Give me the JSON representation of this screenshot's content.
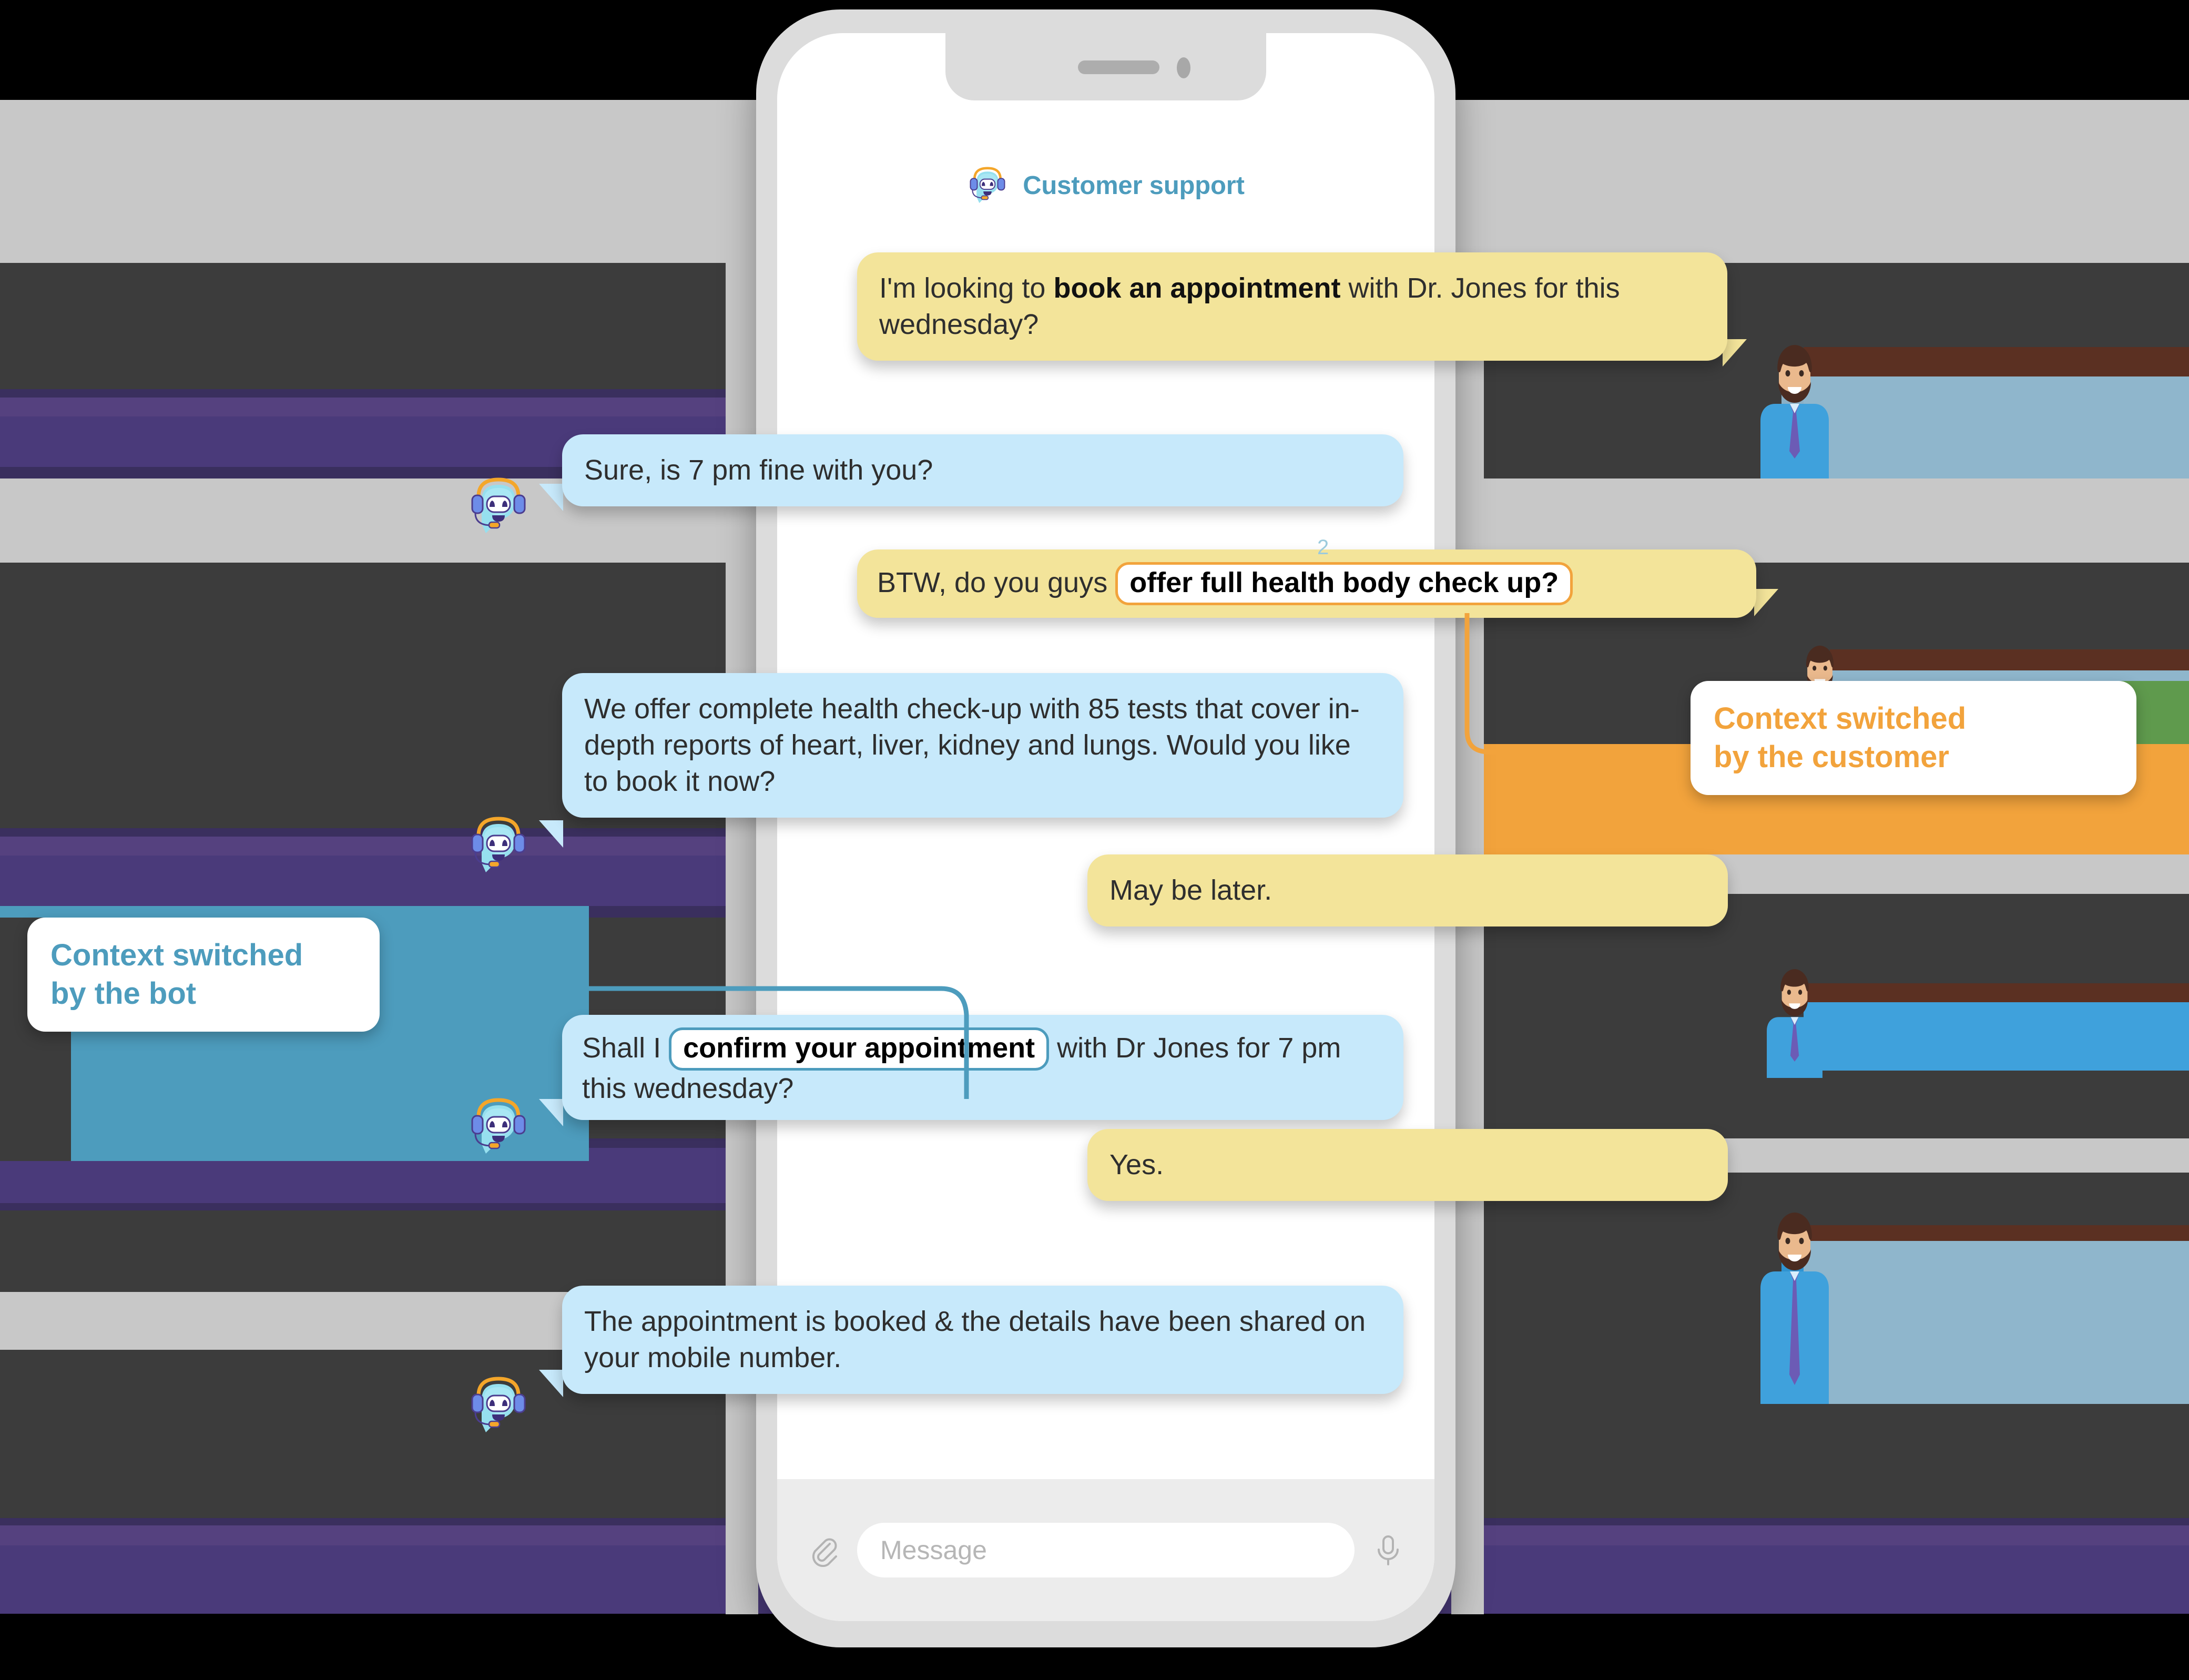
{
  "app": {
    "header_title": "Customer support",
    "bot_icon": "chatbot-headset-icon"
  },
  "colors": {
    "user_bubble": "#f3e49a",
    "bot_bubble": "#c7e9fb",
    "accent_orange": "#f2a33c",
    "accent_blue": "#4d9cbd",
    "phone_frame": "#dcdcdc",
    "background_gray": "#c8c8c8",
    "background_dark": "#3c3c3c",
    "background_purple": "#4a3a7a"
  },
  "conversation": [
    {
      "id": "msg-1",
      "sender": "user",
      "text_parts": [
        {
          "text": "I'm looking to ",
          "bold": false
        },
        {
          "text": "book an appointment",
          "bold": true
        },
        {
          "text": " with Dr. Jones for this wednesday?",
          "bold": false
        }
      ],
      "plain": "I'm looking to book an appointment with Dr. Jones for this wednesday?"
    },
    {
      "id": "msg-2",
      "sender": "bot",
      "plain": "Sure, is 7 pm fine with you?"
    },
    {
      "id": "msg-3",
      "sender": "user",
      "prefix": "BTW, do you guys ",
      "highlight": "offer full health body check up?",
      "highlight_style": "orange",
      "marker": "2",
      "plain": "BTW, do you guys offer full health body check up?"
    },
    {
      "id": "msg-4",
      "sender": "bot",
      "plain": "We offer complete health check-up with 85 tests that cover in-depth reports of heart, liver, kidney and lungs. Would you like to book it now?"
    },
    {
      "id": "msg-5",
      "sender": "user",
      "plain": "May be later."
    },
    {
      "id": "msg-6",
      "sender": "bot",
      "prefix": "Shall I ",
      "highlight": "confirm your appointment",
      "highlight_style": "blue",
      "suffix": " with Dr Jones for 7 pm this wednesday?",
      "plain": "Shall I confirm your appointment with Dr Jones for 7 pm this wednesday?"
    },
    {
      "id": "msg-7",
      "sender": "user",
      "plain": "Yes."
    },
    {
      "id": "msg-8",
      "sender": "bot",
      "plain": "The appointment is booked & the details have been shared on your mobile number."
    }
  ],
  "callouts": [
    {
      "id": "callout-customer",
      "line1": "Context switched",
      "line2": "by the customer",
      "color": "#f2a33c",
      "side": "right"
    },
    {
      "id": "callout-bot",
      "line1": "Context switched",
      "line2": "by the bot",
      "color": "#4d9cbd",
      "side": "left"
    }
  ],
  "input_bar": {
    "placeholder": "Message",
    "attach_icon": "paperclip-icon",
    "mic_icon": "microphone-icon"
  }
}
